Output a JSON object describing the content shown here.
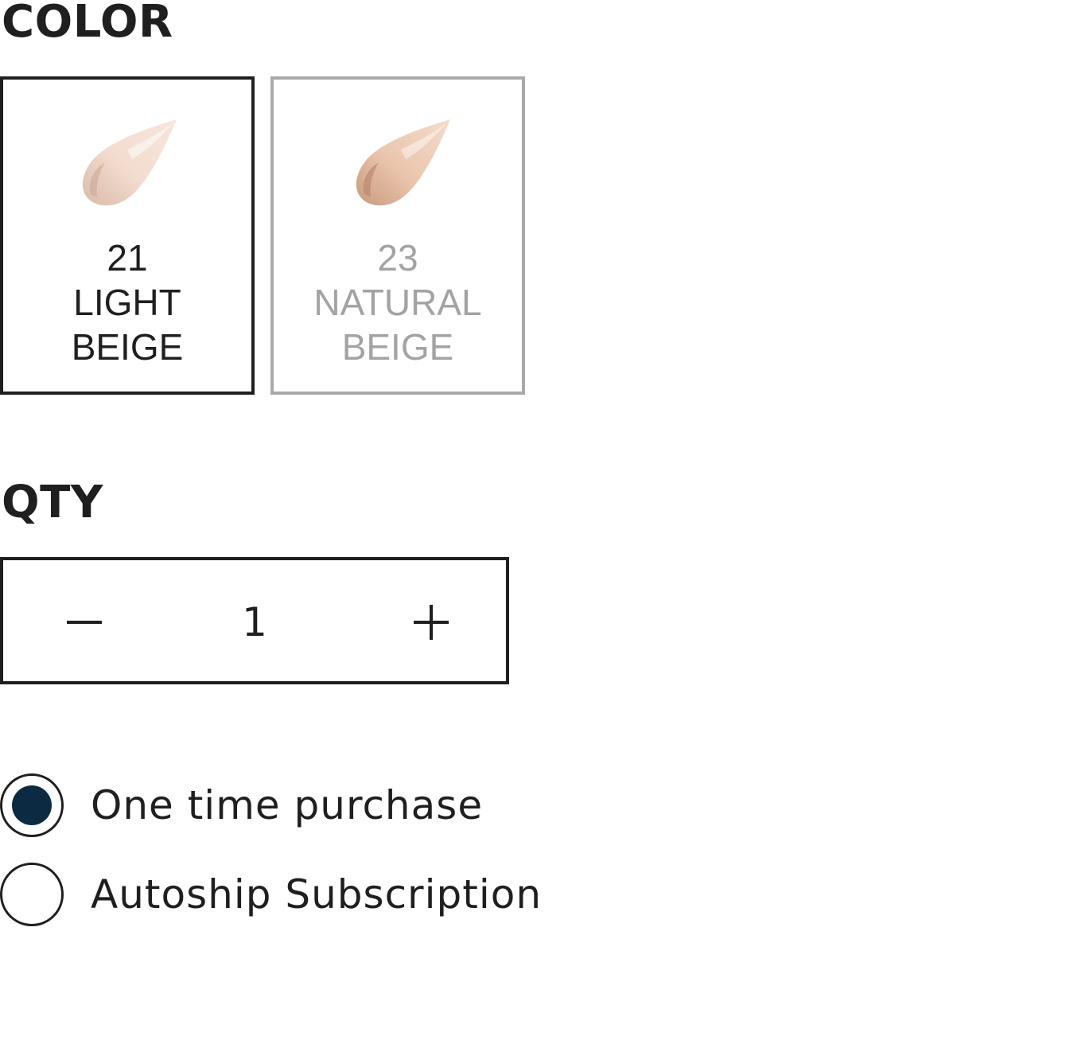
{
  "color_section": {
    "label": "COLOR",
    "swatches": [
      {
        "number": "21",
        "name_line1": "LIGHT",
        "name_line2": "BEIGE",
        "selected": true,
        "color": "#f0d5c6"
      },
      {
        "number": "23",
        "name_line1": "NATURAL",
        "name_line2": "BEIGE",
        "selected": false,
        "color": "#e6bfa6"
      }
    ]
  },
  "qty_section": {
    "label": "QTY",
    "value": "1",
    "decrement_icon": "minus-icon",
    "increment_icon": "plus-icon"
  },
  "purchase_options": [
    {
      "label": "One time purchase",
      "selected": true
    },
    {
      "label": "Autoship Subscription",
      "selected": false
    }
  ],
  "colors": {
    "text": "#1f1f1f",
    "unselected_border": "#a9a9a9",
    "unselected_text": "#a3a3a3",
    "radio_fill": "#0c2a42"
  }
}
